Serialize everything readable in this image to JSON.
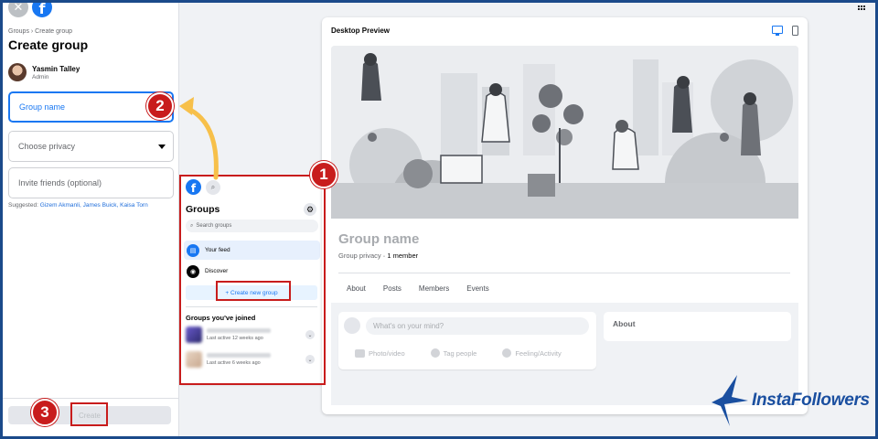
{
  "left_panel": {
    "breadcrumb": "Groups › Create group",
    "title": "Create group",
    "admin_name": "Yasmin Talley",
    "admin_role": "Admin",
    "group_name_placeholder": "Group name",
    "privacy_placeholder": "Choose privacy",
    "invite_placeholder": "Invite friends (optional)",
    "suggested_label": "Suggested:",
    "suggested_names": "Gizem Akmanli, James Buick, Kaisa Torn",
    "create_label": "Create"
  },
  "annotations": [
    "1",
    "2",
    "3"
  ],
  "mini_groups": {
    "title": "Groups",
    "search_placeholder": "Search groups",
    "your_feed": "Your feed",
    "discover": "Discover",
    "create_new_group": "+ Create new group",
    "joined_title": "Groups you've joined",
    "joined": [
      {
        "last_active": "Last active 12 weeks ago"
      },
      {
        "last_active": "Last active 6 weeks ago"
      }
    ]
  },
  "preview": {
    "title": "Desktop Preview",
    "group_name": "Group name",
    "privacy": "Group privacy",
    "members": " · 1 member",
    "tabs": [
      "About",
      "Posts",
      "Members",
      "Events"
    ],
    "composer_placeholder": "What's on your mind?",
    "actions": [
      "Photo/video",
      "Tag people",
      "Feeling/Activity"
    ],
    "about_card": "About"
  },
  "brand": {
    "text": "InstaFollowers"
  },
  "colors": {
    "accent": "#1877f2",
    "annotation_red": "#c81c1c",
    "arrow_yellow": "#f7c04a",
    "frame_blue": "#1b4a8a"
  }
}
